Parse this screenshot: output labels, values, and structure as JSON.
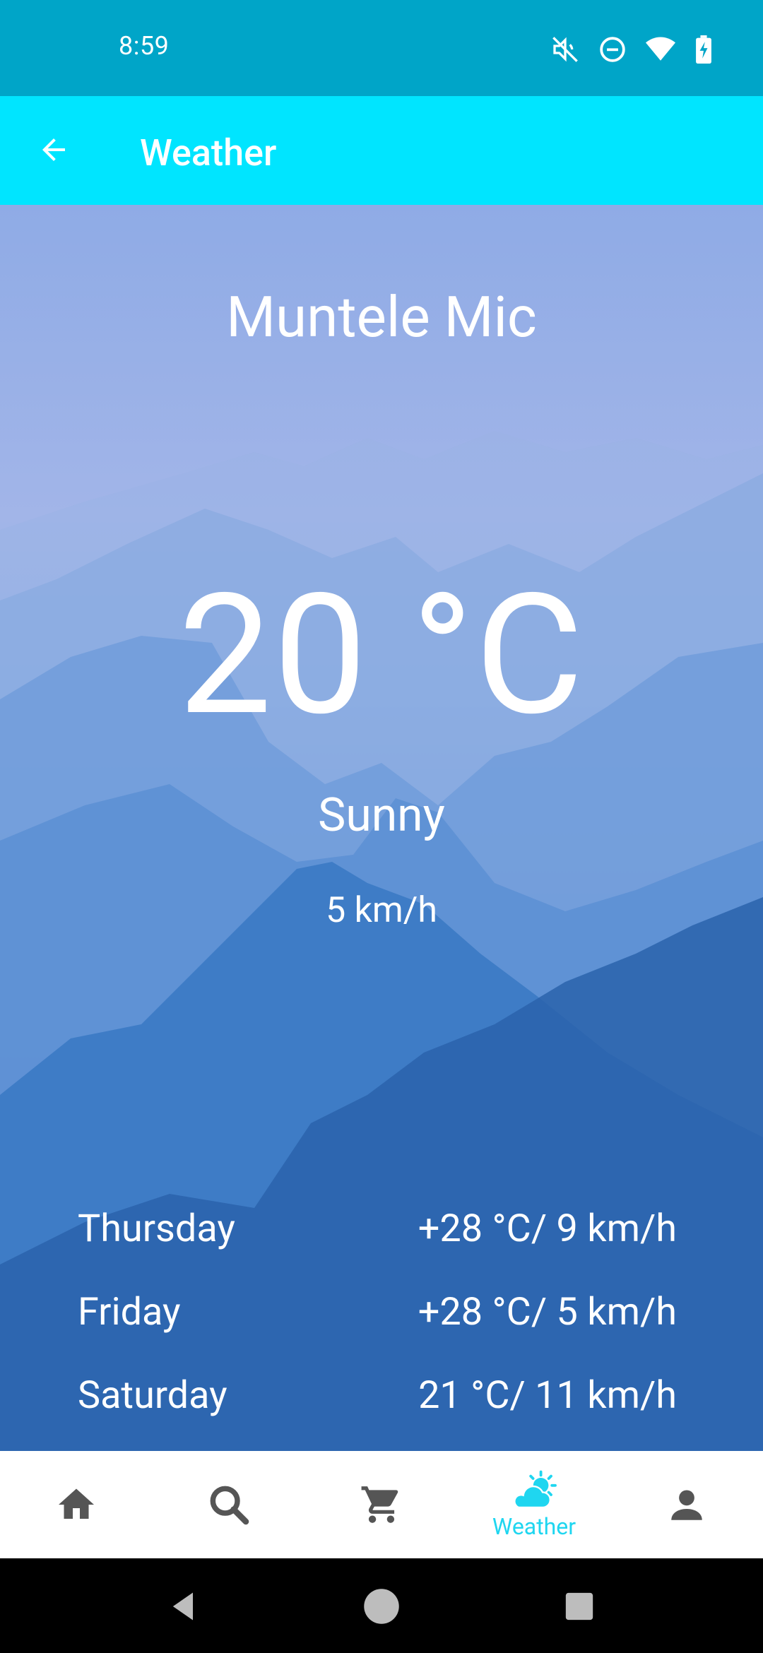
{
  "status": {
    "time": "8:59",
    "icons": [
      "mute-icon",
      "dnd-icon",
      "wifi-icon",
      "battery-charging-icon"
    ]
  },
  "app_bar": {
    "title": "Weather",
    "back_icon": "arrow-left-icon"
  },
  "weather": {
    "city": "Muntele Mic",
    "temperature": "20 °C",
    "condition": "Sunny",
    "wind": "5 km/h"
  },
  "forecast": [
    {
      "day": "Thursday",
      "value": "+28 °C/ 9 km/h"
    },
    {
      "day": "Friday",
      "value": "+28 °C/ 5 km/h"
    },
    {
      "day": "Saturday",
      "value": "21 °C/ 11 km/h"
    }
  ],
  "bottom_nav": {
    "items": [
      {
        "icon": "home-icon",
        "label": ""
      },
      {
        "icon": "search-icon",
        "label": ""
      },
      {
        "icon": "cart-icon",
        "label": ""
      },
      {
        "icon": "weather-icon",
        "label": "Weather",
        "active": true
      },
      {
        "icon": "person-icon",
        "label": ""
      }
    ],
    "active_color": "#1fd6f0",
    "inactive_color": "#555555"
  },
  "colors": {
    "status_bar": "#00a5c8",
    "app_bar": "#00e5ff"
  }
}
